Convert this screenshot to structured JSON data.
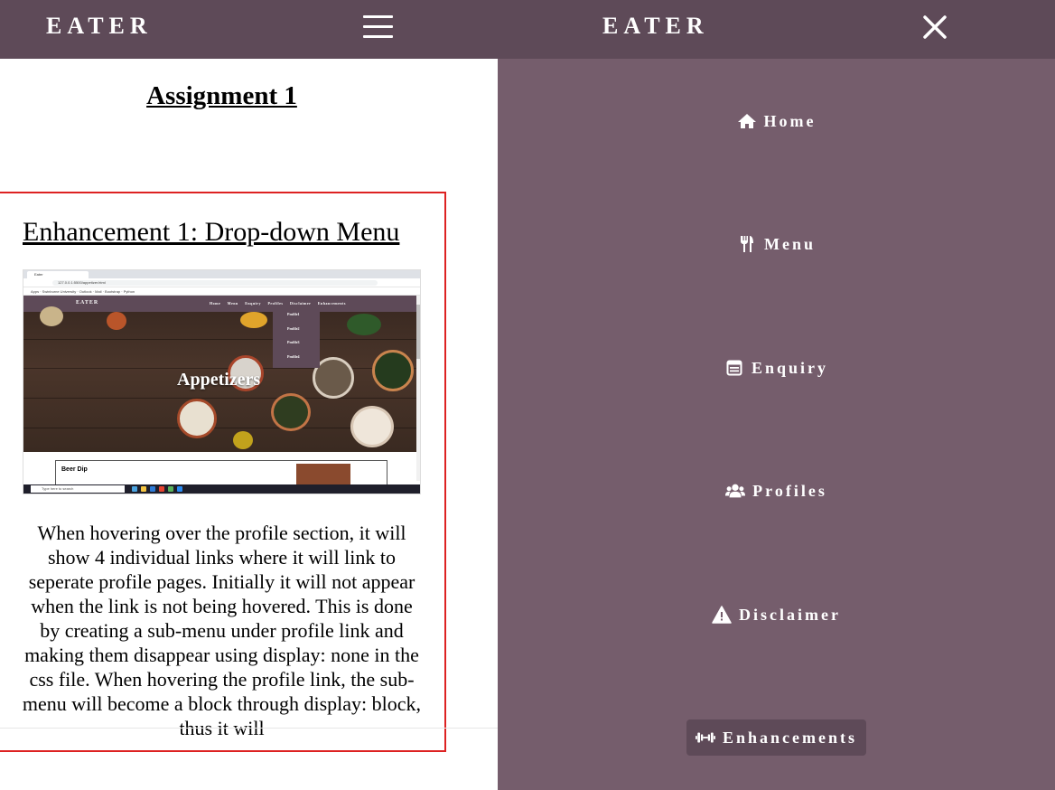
{
  "header": {
    "brand_left": "EATER",
    "brand_right": "EATER"
  },
  "main": {
    "page_title": "Assignment 1",
    "card": {
      "title": "Enhancement 1: Drop-down Menu",
      "description": "When hovering over the profile section, it will show 4 individual links where it will link to seperate profile pages. Initially it will not appear when the link is not being hovered. This is done by creating a sub-menu under profile link and making them disappear using display: none in the css file. When hovering the profile link, the sub-menu will become a block through display: block, thus it will",
      "screenshot": {
        "nav_brand": "EATER",
        "nav_links": "Home Menu Enquiry Profiles Disclaimer Enhancements",
        "dropdown": [
          "Profile1",
          "Profile2",
          "Profile3",
          "Profile4"
        ],
        "hero_title": "Appetizers",
        "panel_title": "Beer Dip",
        "search_placeholder": "Type here to search"
      }
    }
  },
  "menu": {
    "items": [
      {
        "label": "Home",
        "icon": "home-icon"
      },
      {
        "label": "Menu",
        "icon": "utensils-icon"
      },
      {
        "label": "Enquiry",
        "icon": "form-icon"
      },
      {
        "label": "Profiles",
        "icon": "users-icon"
      },
      {
        "label": "Disclaimer",
        "icon": "warning-icon"
      },
      {
        "label": "Enhancements",
        "icon": "dumbbell-icon",
        "active": true
      }
    ]
  },
  "colors": {
    "header": "#5e4a58",
    "menu_bg": "#755d6c",
    "card_border": "#dd2222",
    "active_item": "#5e4a58"
  }
}
